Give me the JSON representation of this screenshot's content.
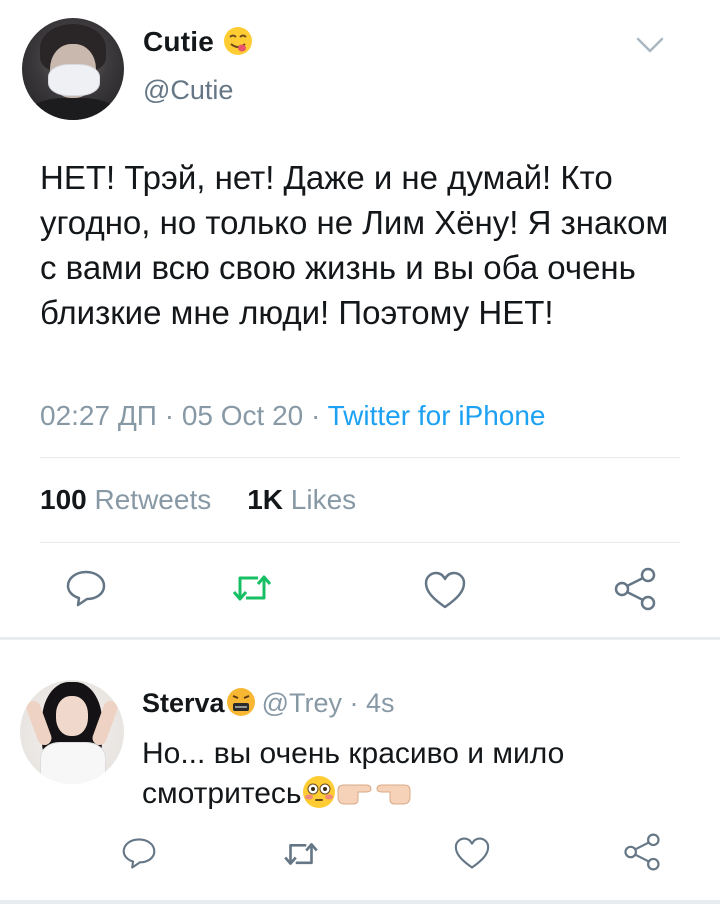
{
  "tweet": {
    "display_name": "Cutie",
    "name_emoji": "smiling-face-tongue-emoji",
    "handle": "@Cutie",
    "text": "НЕТ! Трэй, нет! Даже и не думай! Кто угодно, но только не Лим Хёну! Я знаком с вами всю свою жизнь и вы оба очень близкие мне люди! Поэтому НЕТ!",
    "time": "02:27 ДП",
    "date": "05 Oct 20",
    "source": "Twitter for iPhone",
    "retweets_count": "100",
    "retweets_label": "Retweets",
    "likes_count": "1K",
    "likes_label": "Likes"
  },
  "reply": {
    "display_name": "Sterva",
    "name_emoji": "grimacing-angry-face-emoji",
    "handle": "@Trey",
    "time": "4s",
    "text": "Но... вы очень красиво и мило смотритесь",
    "text_emojis": [
      "flushed-face-emoji",
      "pointing-right-hand-emoji",
      "pointing-left-hand-emoji"
    ]
  },
  "colors": {
    "text": "#14171a",
    "secondary": "#8899a6",
    "link": "#1da1f2",
    "retweet_green": "#17bf63",
    "icon_gray": "#657786",
    "divider": "#e6ecf0"
  },
  "icons": {
    "actions": [
      "reply-icon",
      "retweet-icon",
      "like-icon",
      "share-icon"
    ],
    "menu": "chevron-down-icon"
  }
}
